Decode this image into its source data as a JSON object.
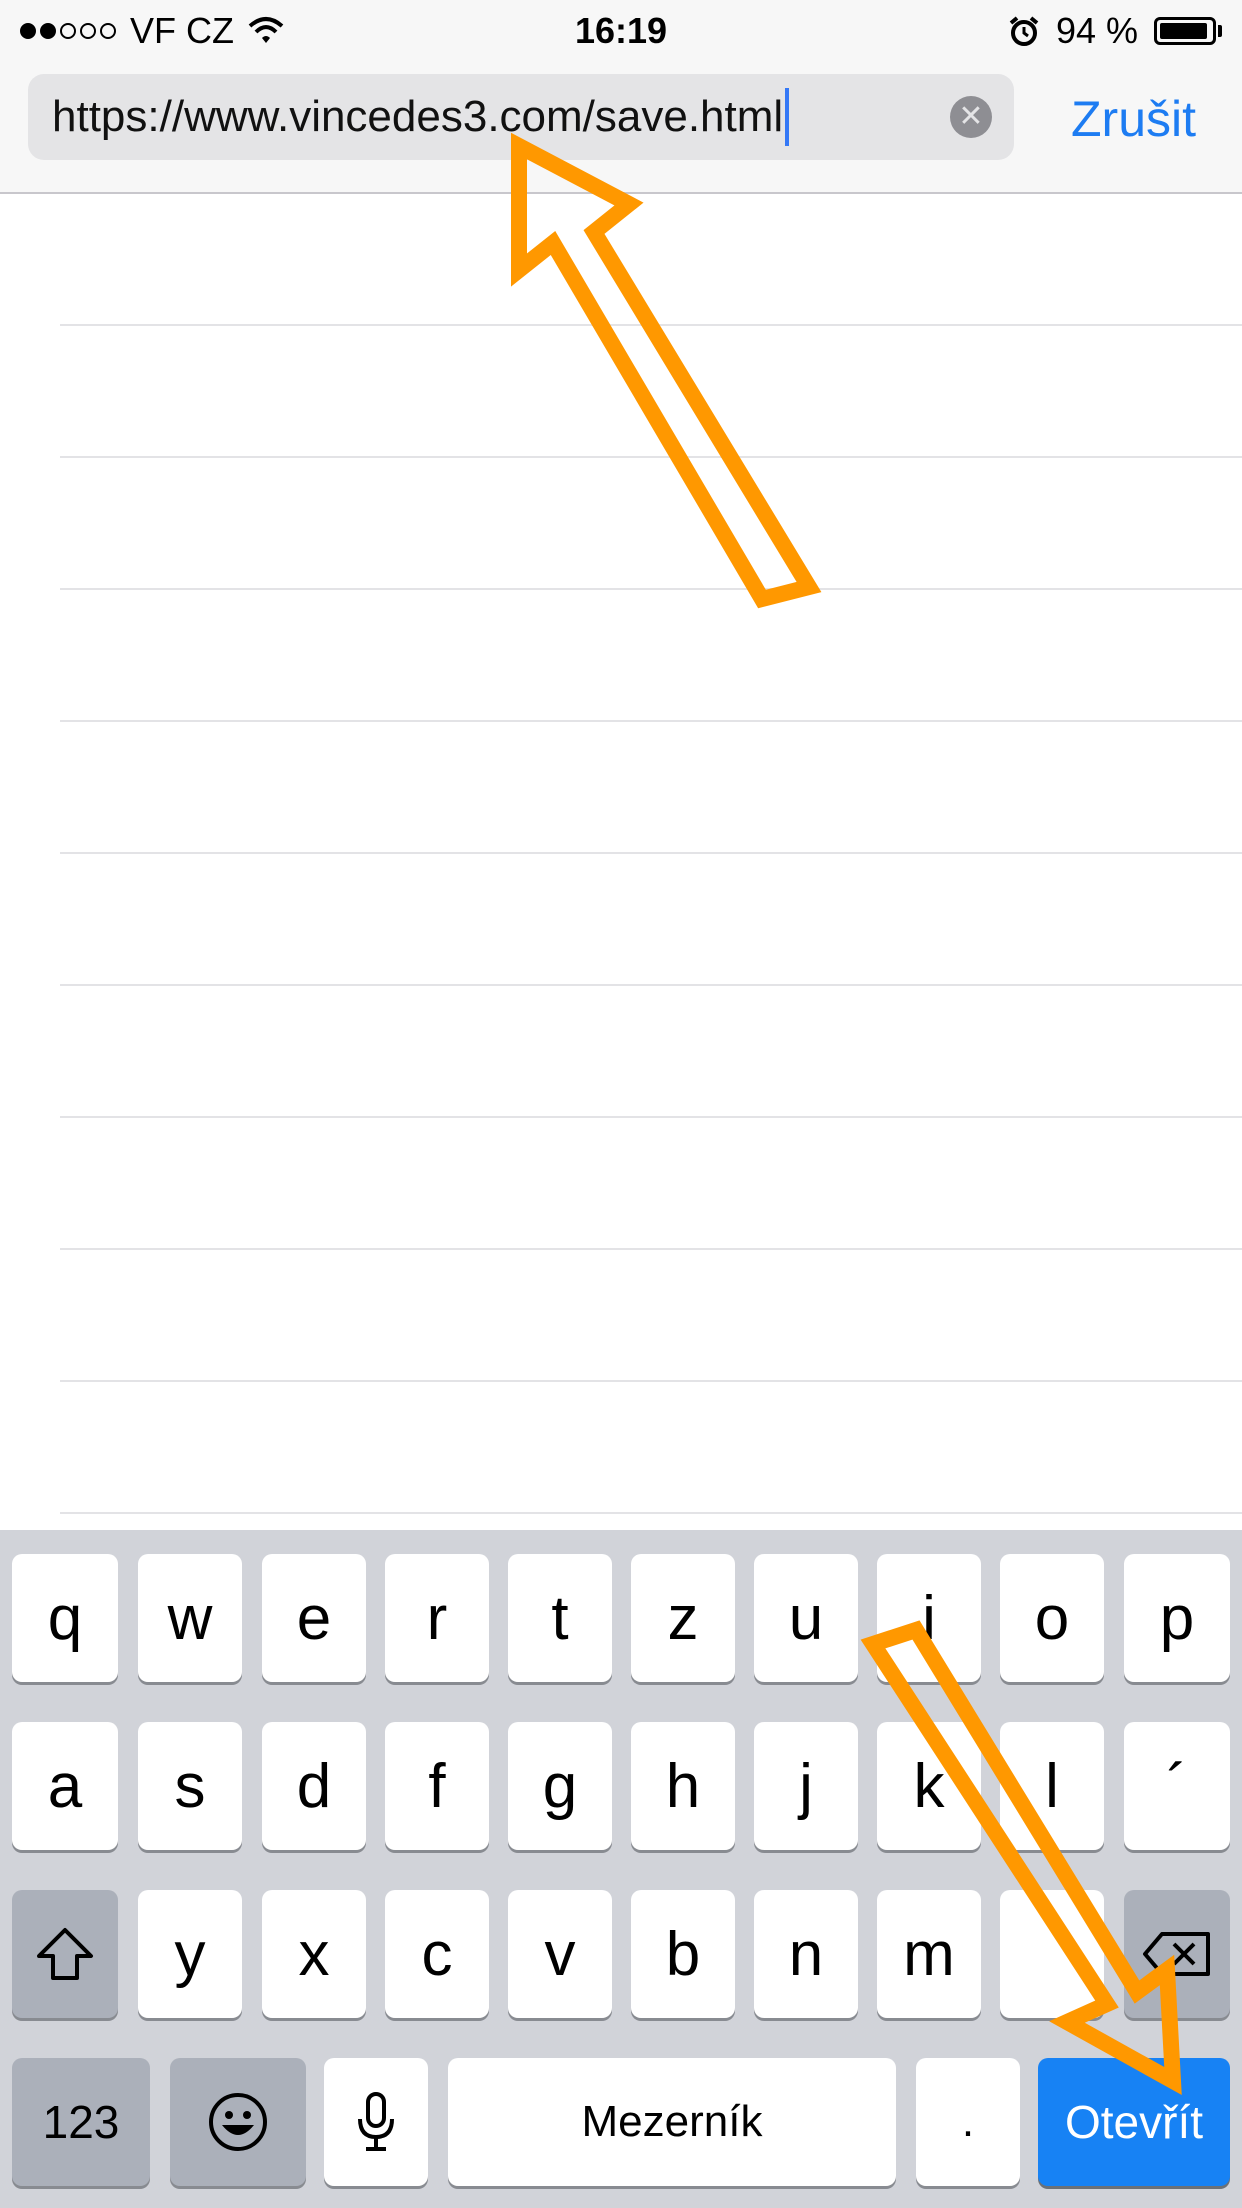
{
  "status_bar": {
    "carrier": "VF CZ",
    "time": "16:19",
    "battery_percent": "94 %",
    "battery_level": 0.94,
    "signal_bars_filled": 2,
    "signal_bars_total": 5,
    "icons": [
      "wifi-icon",
      "alarm-icon",
      "battery-icon"
    ]
  },
  "address_bar": {
    "url": "https://www.vincedes3.com/save.html",
    "cancel_label": "Zrušit",
    "clear_icon": "clear-icon"
  },
  "keyboard": {
    "row1": [
      "q",
      "w",
      "e",
      "r",
      "t",
      "z",
      "u",
      "i",
      "o",
      "p"
    ],
    "row2": [
      "a",
      "s",
      "d",
      "f",
      "g",
      "h",
      "j",
      "k",
      "l",
      "´"
    ],
    "row3": [
      "y",
      "x",
      "c",
      "v",
      "b",
      "n",
      "m"
    ],
    "numbers_label": "123",
    "space_label": "Mezerník",
    "period_label": ".",
    "go_label": "Otevřít",
    "icons": [
      "shift-icon",
      "backspace-icon",
      "emoji-icon",
      "microphone-icon"
    ]
  },
  "annotation_color": "#ff9800"
}
